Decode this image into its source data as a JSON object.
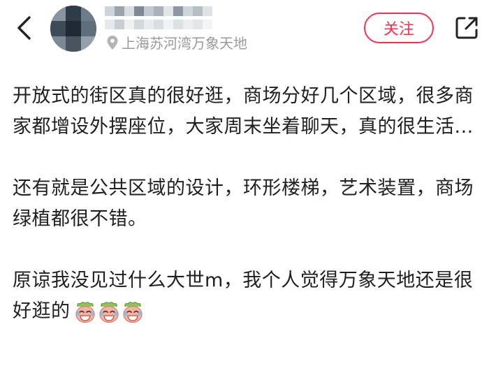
{
  "header": {
    "back_icon": "chevron-left-icon",
    "location_icon": "map-pin-icon",
    "location_text": "上海苏河湾万象天地",
    "follow_label": "关注",
    "share_icon": "share-icon",
    "accent_color": "#ff2e4d"
  },
  "post": {
    "paragraphs": [
      "开放式的街区真的很好逛，商场分好几个区域，很多商家都增设外摆座位，大家周末坐着聊天，真的很生活...",
      "还有就是公共区域的设计，环形楼梯，艺术装置，商场绿植都很不错。",
      "原谅我没见过什么大世m，我个人觉得万象天地还是很好逛的"
    ],
    "trailing_emoji": [
      "laughing-tears-emoji",
      "laughing-tears-emoji",
      "laughing-tears-emoji"
    ]
  }
}
